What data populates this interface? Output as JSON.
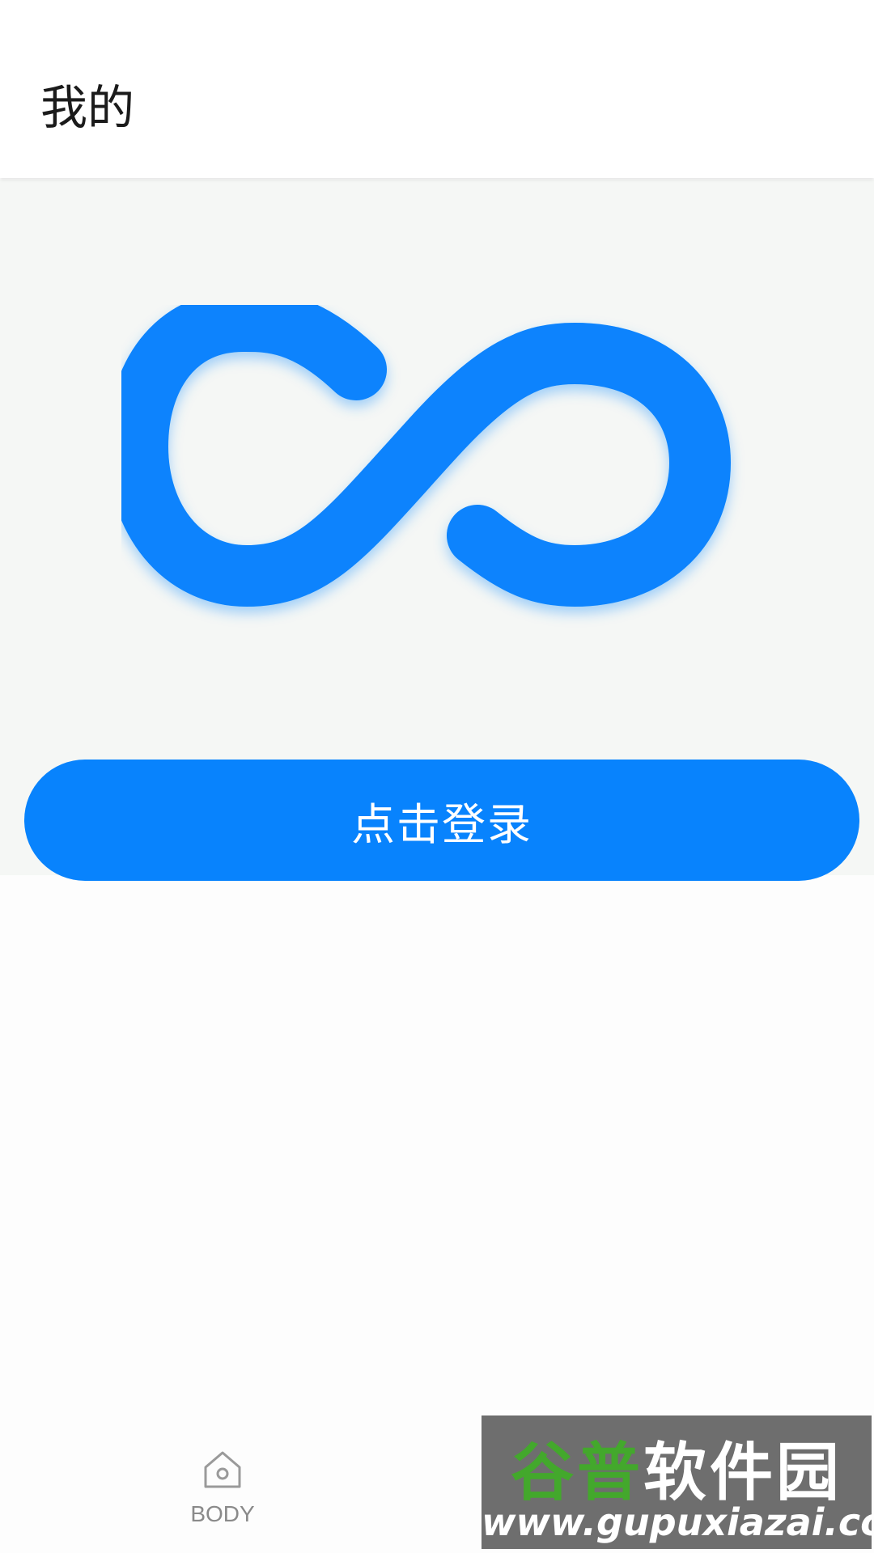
{
  "appbar": {
    "title": "我的"
  },
  "hero": {
    "logo_icon": "infinity-logo-icon",
    "accent_color": "#0883fd"
  },
  "login_button": {
    "label": "点击登录"
  },
  "bottom_nav": {
    "items": [
      {
        "label": "BODY",
        "icon": "home-icon"
      }
    ]
  },
  "watermark": {
    "brand_green": "谷普",
    "brand_white": "软件园",
    "url": "www.gupuxiazai.com"
  }
}
